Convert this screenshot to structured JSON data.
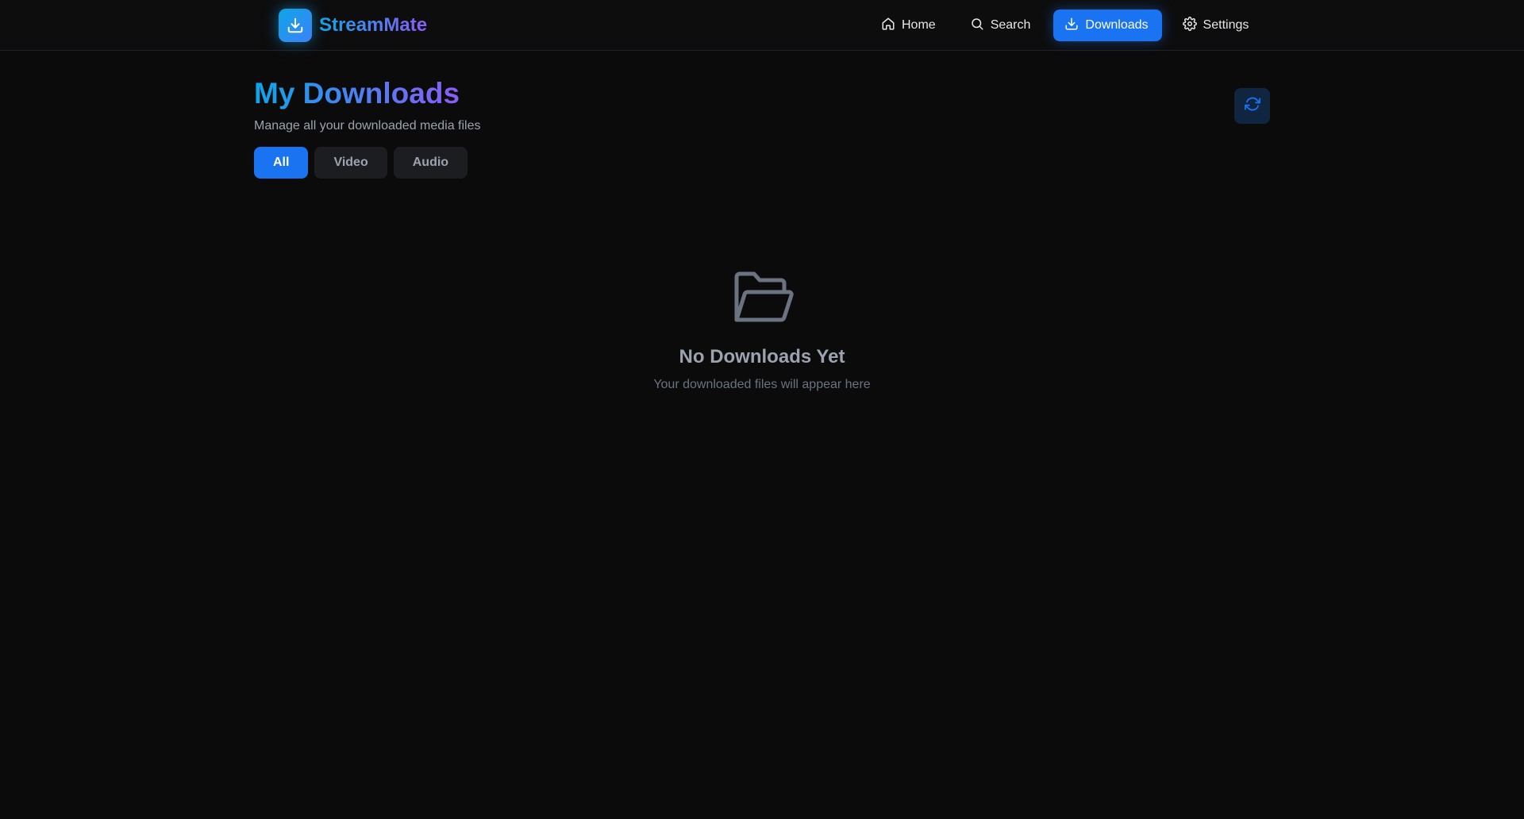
{
  "header": {
    "brand_name": "StreamMate",
    "nav": [
      {
        "label": "Home",
        "icon": "home-icon"
      },
      {
        "label": "Search",
        "icon": "search-icon"
      },
      {
        "label": "Downloads",
        "icon": "download-icon",
        "active": true
      },
      {
        "label": "Settings",
        "icon": "gear-icon"
      }
    ]
  },
  "main": {
    "title": "My Downloads",
    "subtitle": "Manage all your downloaded media files",
    "filters": [
      {
        "label": "All",
        "active": true
      },
      {
        "label": "Video"
      },
      {
        "label": "Audio"
      }
    ],
    "empty_state": {
      "icon": "folder-open-icon",
      "title": "No Downloads Yet",
      "description": "Your downloaded files will appear here"
    },
    "refresh_icon": "refresh-icon"
  },
  "colors": {
    "accent": "#1a73f0",
    "gradient_start": "#0ea5e9",
    "gradient_end": "#8b5cf6",
    "background": "#0b0b0c"
  }
}
